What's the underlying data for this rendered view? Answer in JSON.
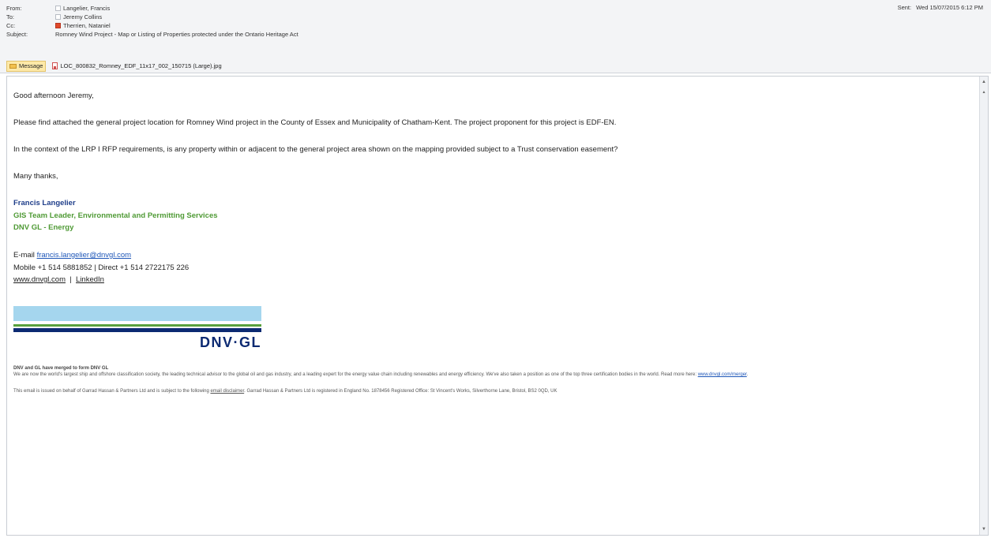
{
  "header": {
    "from_label": "From:",
    "from_value": "Langelier, Francis",
    "to_label": "To:",
    "to_value": "Jeremy Collins",
    "cc_label": "Cc:",
    "cc_value": "Therrien, Nataniel",
    "subject_label": "Subject:",
    "subject_value": "Romney Wind Project - Map or Listing of Properties protected under the Ontario Heritage Act",
    "sent_label": "Sent:",
    "sent_value": "Wed 15/07/2015 6:12 PM"
  },
  "attachments": {
    "message_tab": "Message",
    "file_name": "LOC_800832_Romney_EDF_11x17_002_150715 (Large).jpg"
  },
  "body": {
    "greeting": "Good afternoon Jeremy,",
    "para1": "Please find attached the general project location for Romney Wind project in the County of Essex and Municipality of Chatham-Kent.  The project proponent for this project is EDF-EN.",
    "para2": "In the context of the LRP I RFP requirements, is any property within or adjacent to the general project area shown on the mapping provided subject to a Trust conservation easement?",
    "thanks": "Many thanks,"
  },
  "signature": {
    "name": "Francis Langelier",
    "title": "GIS Team Leader, Environmental and Permitting Services",
    "company": "DNV GL - Energy",
    "email_label": "E-mail ",
    "email": "francis.langelier@dnvgl.com",
    "phone": "Mobile +1 514 5881852  |  Direct +1 514 2722175 226",
    "website": "www.dnvgl.com",
    "separator": "  |  ",
    "linkedin": "LinkedIn"
  },
  "logo": {
    "text": "DNV·GL",
    "colors": {
      "light_blue": "#a5d6ee",
      "green": "#58a13c",
      "navy": "#0c2a72"
    }
  },
  "footer": {
    "merge_title": "DNV and GL have merged to form DNV GL",
    "merge_text": "We are now the world's largest ship and offshore classification society, the leading technical advisor to the global oil and gas industry, and a leading expert for the energy value chain including renewables and energy efficiency. We've also taken a position as one of the top three certification bodies in the world. Read more here: ",
    "merge_link": "www.dnvgl.com/merger",
    "merge_end": ".",
    "disclaimer_start": "This email is issued on behalf of Garrad Hassan & Partners Ltd and is subject to the following ",
    "disclaimer_link": "email disclaimer",
    "disclaimer_end": ". Garrad Hassan & Partners Ltd is registered in England No. 1878456 Registered Office: St Vincent's Works, Silverthorne Lane, Bristol, BS2 0QD, UK"
  }
}
